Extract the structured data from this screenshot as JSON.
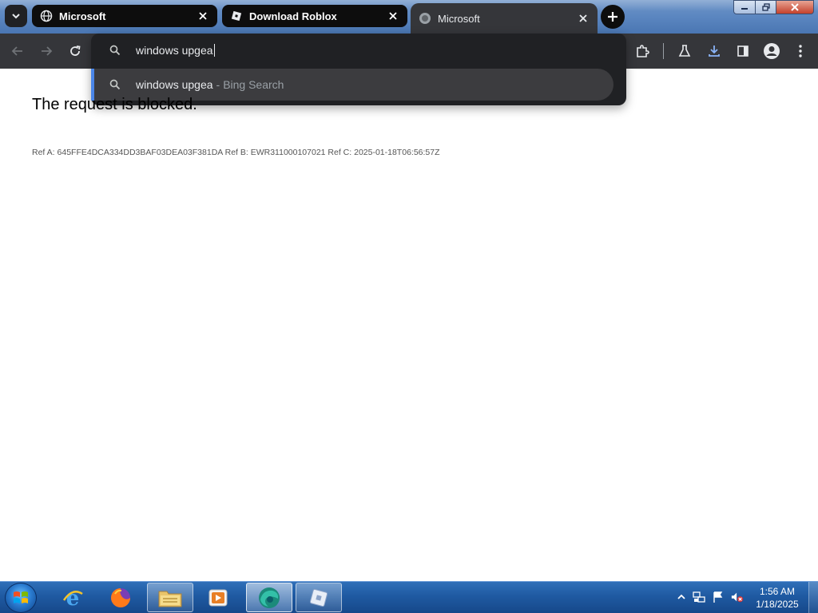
{
  "browser": {
    "tabs": [
      {
        "title": "Microsoft",
        "favicon": "globe-icon",
        "active": false
      },
      {
        "title": "Download Roblox",
        "favicon": "roblox-icon",
        "active": false
      },
      {
        "title": "Microsoft",
        "favicon": "globe-icon",
        "active": true
      }
    ],
    "omnibox": {
      "value": "windows upgea",
      "suggestions": [
        {
          "text": "windows upgea",
          "separator": "-",
          "engine": "Bing Search"
        }
      ]
    }
  },
  "page": {
    "heading": "The request is blocked.",
    "ref_line": "Ref A: 645FFE4DCA334DD3BAF03DEA03F381DA Ref B: EWR311000107021 Ref C: 2025-01-18T06:56:57Z"
  },
  "taskbar": {
    "pinned": [
      "internet-explorer-icon",
      "firefox-icon",
      "file-explorer-icon",
      "media-player-icon",
      "edge-icon",
      "roblox-icon"
    ],
    "clock": {
      "time": "1:56 AM",
      "date": "1/18/2025"
    }
  },
  "colors": {
    "toolbar": "#35363a",
    "omnibox": "#202124",
    "suggestion_highlight": "#3c3c3f",
    "suggestion_accent": "#4a86e8",
    "downloads_accent": "#8ab4f8",
    "taskbar": "#1f5aa2"
  }
}
